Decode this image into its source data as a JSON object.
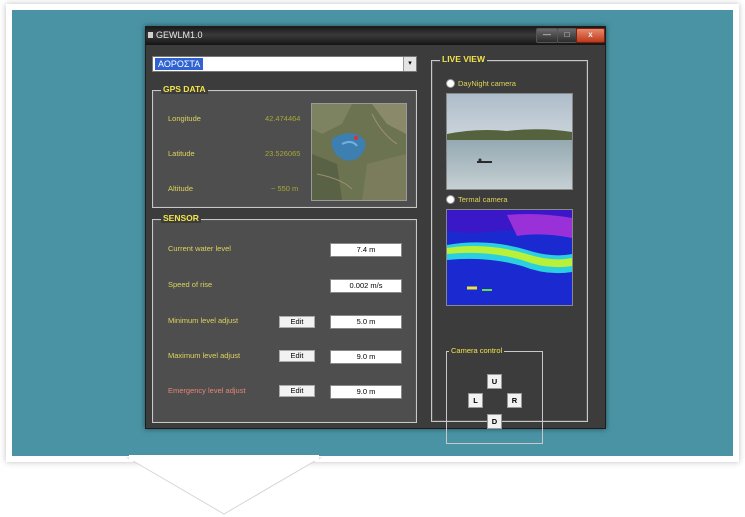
{
  "window": {
    "title": "GEWLM1.0",
    "min_label": "—",
    "max_label": "□",
    "close_label": "x"
  },
  "combo": {
    "value": "ΑΟΡΟΣΤΑ",
    "drop_icon": "▾"
  },
  "gps": {
    "legend": "GPS DATA",
    "rows": [
      {
        "label": "Longitude",
        "value": "42.474464"
      },
      {
        "label": "Latitude",
        "value": "23.526065"
      },
      {
        "label": "Altitude",
        "value": "~ 550 m"
      }
    ]
  },
  "sensor": {
    "legend": "SENSOR",
    "current_label": "Current water level",
    "current_value": "7.4 m",
    "speed_label": "Speed of rise",
    "speed_value": "0.002 m/s",
    "min_label": "Minimum level adjust",
    "min_value": "5.0 m",
    "max_label": "Maximum level adjust",
    "max_value": "9.0 m",
    "emergency_label": "Emergency level adjust",
    "emergency_value": "9.0 m",
    "edit_label": "Edit"
  },
  "live": {
    "legend": "LIVE VIEW",
    "daynight_label": "DayNight camera",
    "thermal_label": "Termal camera",
    "control_legend": "Camera control",
    "up": "U",
    "left": "L",
    "right": "R",
    "down": "D"
  },
  "colors": {
    "teal": "#4993a5",
    "label_yellow": "#ddd45a",
    "emergency_red": "#e88577",
    "panel": "#4e4e4e"
  }
}
